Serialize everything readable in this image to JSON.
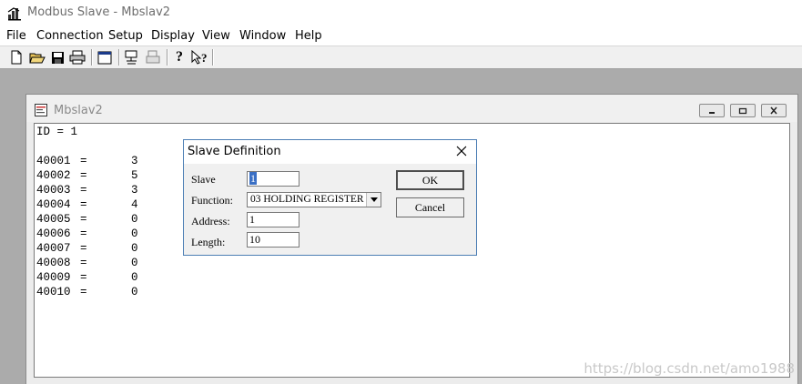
{
  "app": {
    "title": "Modbus Slave - Mbslav2"
  },
  "menu": [
    "File",
    "Connection",
    "Setup",
    "Display",
    "View",
    "Window",
    "Help"
  ],
  "toolbar": {
    "icons": [
      "new-document-icon",
      "open-folder-icon",
      "save-icon",
      "print-icon",
      "window-icon",
      "connect-icon",
      "disconnect-icon",
      "help-icon",
      "context-help-icon"
    ]
  },
  "child_window": {
    "title": "Mbslav2",
    "id_line": "ID = 1",
    "registers": [
      {
        "addr": "40001",
        "eq": "=",
        "value": "3"
      },
      {
        "addr": "40002",
        "eq": "=",
        "value": "5"
      },
      {
        "addr": "40003",
        "eq": "=",
        "value": "3"
      },
      {
        "addr": "40004",
        "eq": "=",
        "value": "4"
      },
      {
        "addr": "40005",
        "eq": "=",
        "value": "0"
      },
      {
        "addr": "40006",
        "eq": "=",
        "value": "0"
      },
      {
        "addr": "40007",
        "eq": "=",
        "value": "0"
      },
      {
        "addr": "40008",
        "eq": "=",
        "value": "0"
      },
      {
        "addr": "40009",
        "eq": "=",
        "value": "0"
      },
      {
        "addr": "40010",
        "eq": "=",
        "value": "0"
      }
    ]
  },
  "dialog": {
    "title": "Slave Definition",
    "slave_label": "Slave",
    "slave_value": "1",
    "function_label": "Function:",
    "function_value": "03 HOLDING REGISTER",
    "address_label": "Address:",
    "address_value": "1",
    "length_label": "Length:",
    "length_value": "10",
    "ok_label": "OK",
    "cancel_label": "Cancel"
  },
  "watermark": "https://blog.csdn.net/amo1988"
}
